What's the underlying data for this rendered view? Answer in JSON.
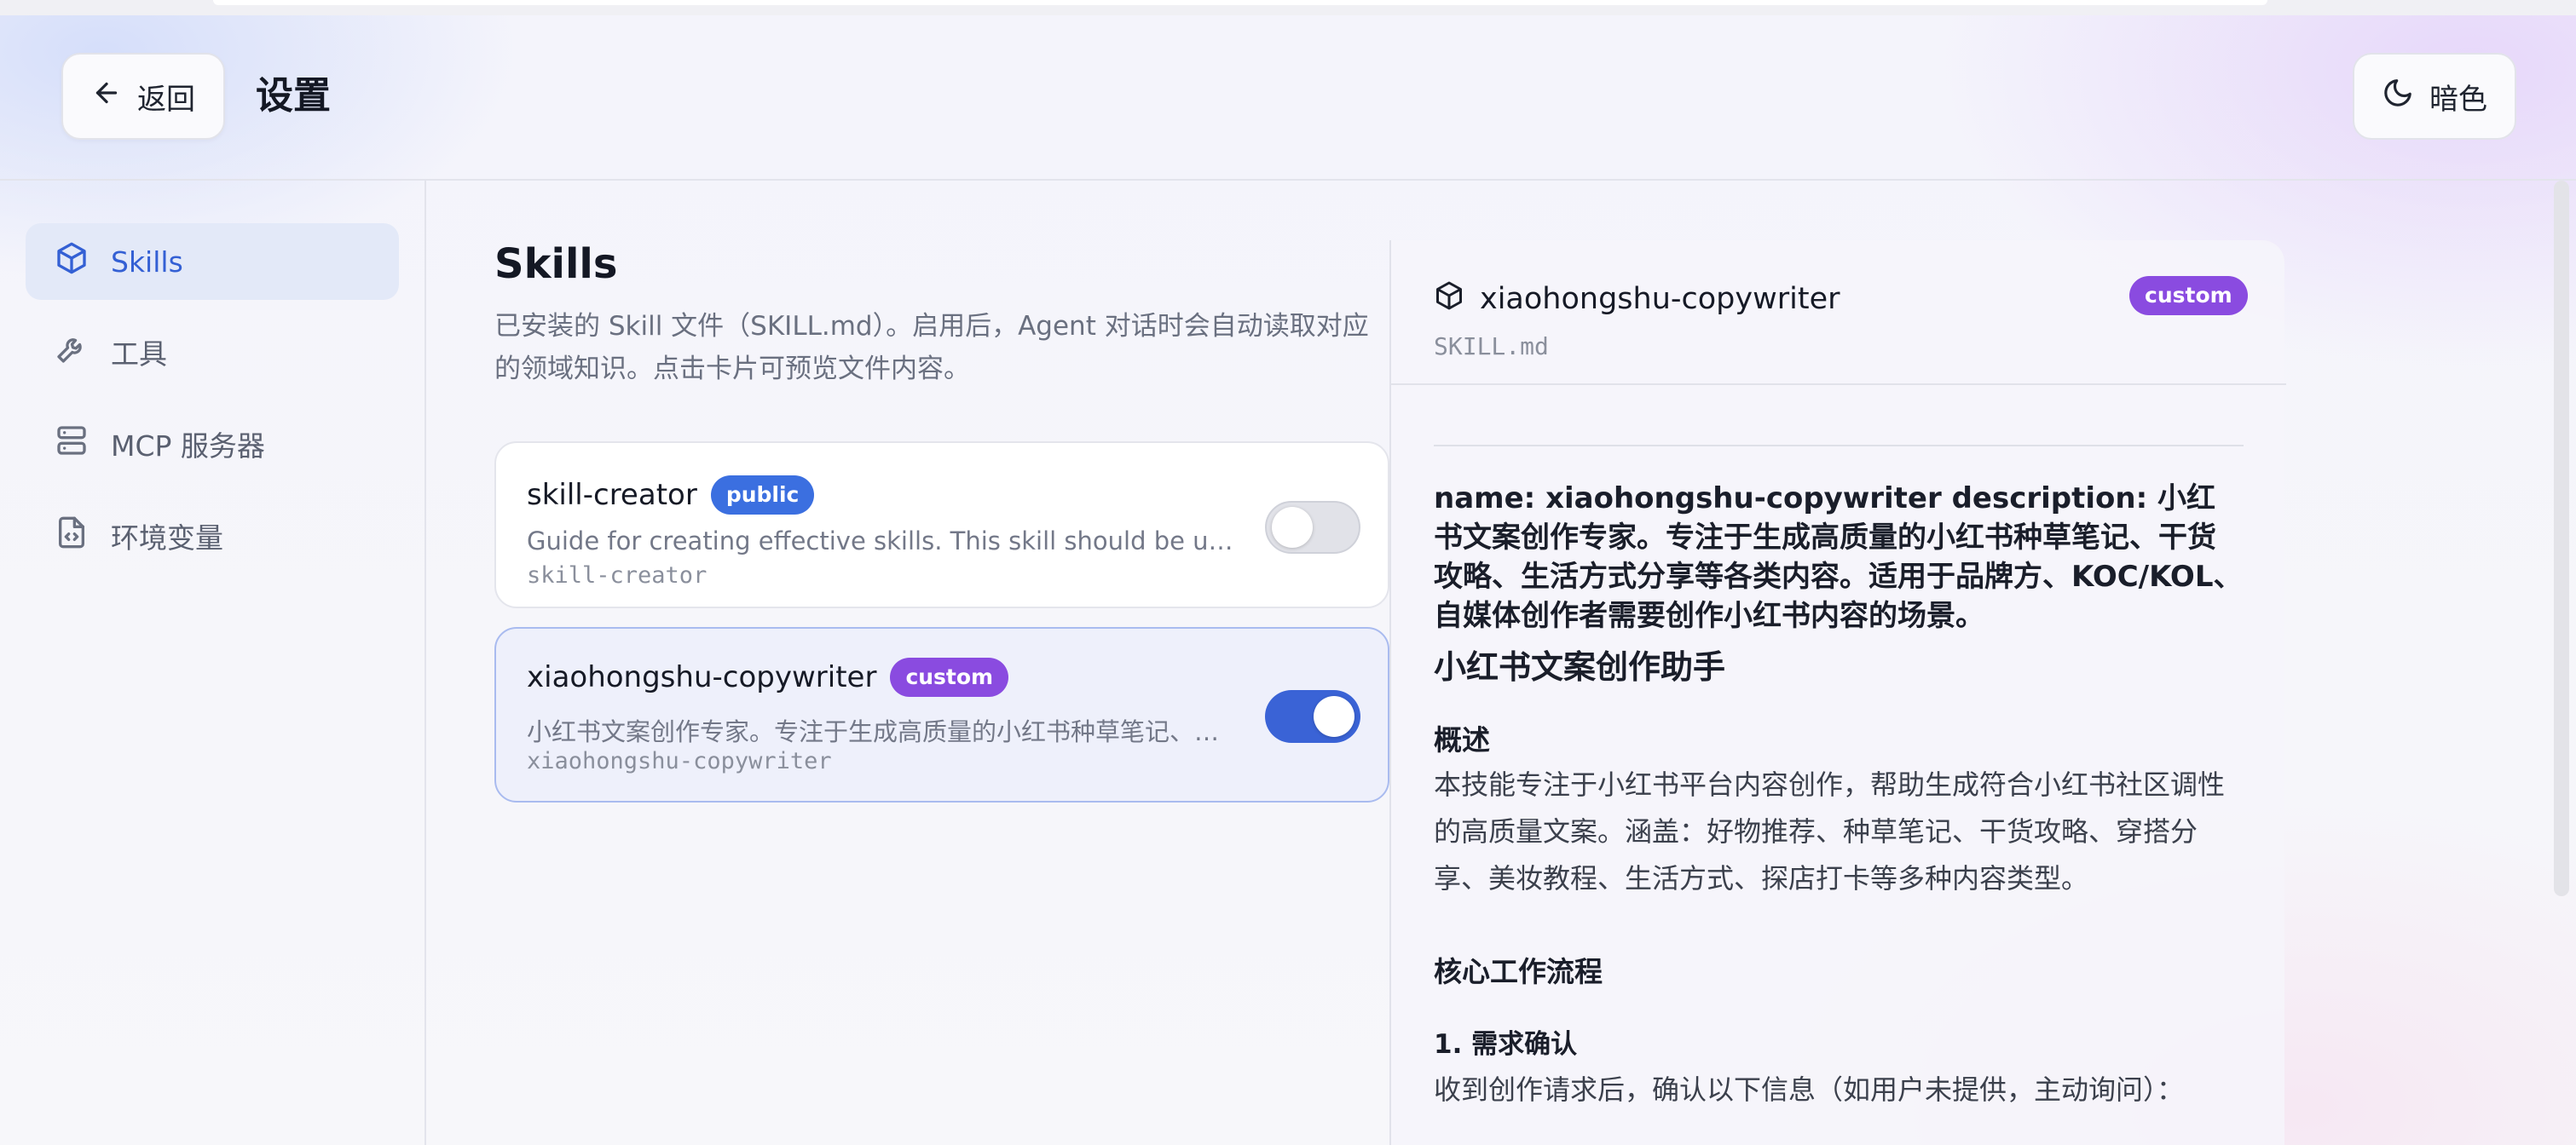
{
  "header": {
    "back_label": "返回",
    "title": "设置",
    "theme_label": "暗色"
  },
  "sidebar": {
    "items": [
      {
        "label": "Skills",
        "icon": "cube-icon",
        "active": true
      },
      {
        "label": "工具",
        "icon": "wrench-icon",
        "active": false
      },
      {
        "label": "MCP 服务器",
        "icon": "server-icon",
        "active": false
      },
      {
        "label": "环境变量",
        "icon": "file-code-icon",
        "active": false
      }
    ]
  },
  "main": {
    "title": "Skills",
    "description": "已安装的 Skill 文件（SKILL.md）。启用后，Agent 对话时会自动读取对应的领域知识。点击卡片可预览文件内容。",
    "skills": [
      {
        "name": "skill-creator",
        "badge": "public",
        "description": "Guide for creating effective skills. This skill should be used when users want to create a new skill",
        "id": "skill-creator",
        "enabled": false
      },
      {
        "name": "xiaohongshu-copywriter",
        "badge": "custom",
        "description": "小红书文案创作专家。专注于生成高质量的小红书种草笔记、干货攻略、生活方式分享等各类内容",
        "id": "xiaohongshu-copywriter",
        "enabled": true
      }
    ]
  },
  "preview": {
    "name": "xiaohongshu-copywriter",
    "badge": "custom",
    "file": "SKILL.md",
    "front_matter": "name: xiaohongshu-copywriter description: 小红书文案创作专家。专注于生成高质量的小红书种草笔记、干货攻略、生活方式分享等各类内容。适用于品牌方、KOC/KOL、自媒体创作者需要创作小红书内容的场景。",
    "h1": "小红书文案创作助手",
    "h2_overview": "概述",
    "overview_text": "本技能专注于小红书平台内容创作，帮助生成符合小红书社区调性的高质量文案。涵盖：好物推荐、种草笔记、干货攻略、穿搭分享、美妆教程、生活方式、探店打卡等多种内容类型。",
    "h2_workflow": "核心工作流程",
    "h3_step1": "1. 需求确认",
    "step1_text": "收到创作请求后，确认以下信息（如用户未提供，主动询问）："
  },
  "colors": {
    "accent": "#3a63d6",
    "public_badge": "#3b6fe0",
    "custom_badge": "#8a4be0",
    "active_nav_bg": "#e3e9f8"
  }
}
